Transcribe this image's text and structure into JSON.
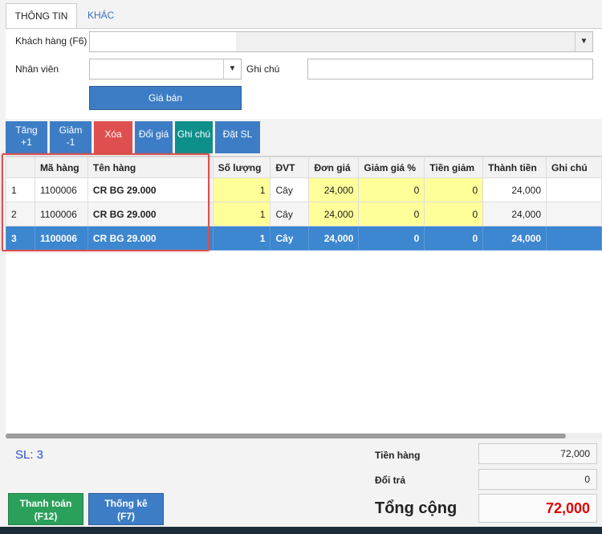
{
  "tabs": {
    "info": "THÔNG TIN",
    "other": "KHÁC"
  },
  "form": {
    "customer_label": "Khách hàng (F6)",
    "customer_value": "",
    "staff_label": "Nhân viên",
    "staff_value": "",
    "note_label": "Ghi chú",
    "note_value": "",
    "price_button": "Giá bán"
  },
  "toolbar": {
    "inc_line1": "Tăng",
    "inc_line2": "+1",
    "dec_line1": "Giảm",
    "dec_line2": "-1",
    "delete": "Xóa",
    "change_price": "Đổi giá",
    "note": "Ghi chú",
    "set_qty": "Đặt SL"
  },
  "table": {
    "headers": [
      "",
      "Mã hàng",
      "Tên hàng",
      "Số lượng",
      "ĐVT",
      "Đơn giá",
      "Giảm giá %",
      "Tiền giảm",
      "Thành tiền",
      "Ghi chú"
    ],
    "rows": [
      {
        "no": "1",
        "code": "1100006",
        "name": "CR BG 29.000",
        "qty": "1",
        "unit": "Cây",
        "price": "24,000",
        "disc_pct": "0",
        "disc_amt": "0",
        "total": "24,000",
        "note": ""
      },
      {
        "no": "2",
        "code": "1100006",
        "name": "CR BG 29.000",
        "qty": "1",
        "unit": "Cây",
        "price": "24,000",
        "disc_pct": "0",
        "disc_amt": "0",
        "total": "24,000",
        "note": ""
      },
      {
        "no": "3",
        "code": "1100006",
        "name": "CR BG 29.000",
        "qty": "1",
        "unit": "Cây",
        "price": "24,000",
        "disc_pct": "0",
        "disc_amt": "0",
        "total": "24,000",
        "note": ""
      }
    ]
  },
  "summary": {
    "count": "SL: 3",
    "subtotal_label": "Tiền hàng",
    "subtotal_value": "72,000",
    "return_label": "Đổi trả",
    "return_value": "0",
    "total_label": "Tổng cộng",
    "total_value": "72,000"
  },
  "actions": {
    "pay_line1": "Thanh toán",
    "pay_line2": "(F12)",
    "stats_line1": "Thống kê",
    "stats_line2": "(F7)"
  },
  "colors": {
    "primary_blue": "#3d7dc6",
    "delete_red": "#e04f4f",
    "teal": "#0e8f8a",
    "pay_green": "#2aa05a",
    "total_red": "#e00000",
    "selected_row": "#3d86d0",
    "editable_yellow": "#ffff99"
  }
}
